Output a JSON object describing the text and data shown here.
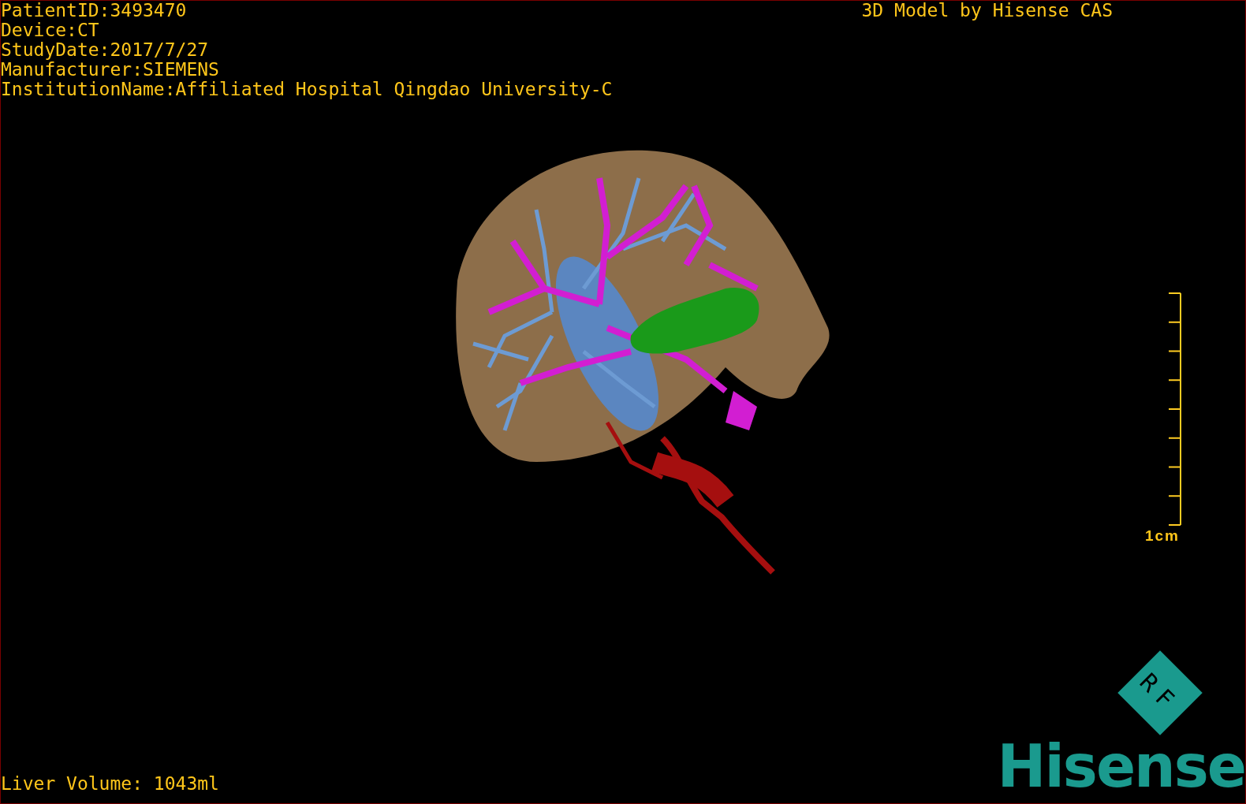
{
  "patient_info": [
    "PatientID:3493470",
    "Device:CT",
    "StudyDate:2017/7/27",
    "Manufacturer:SIEMENS",
    "InstitutionName:Affiliated Hospital Qingdao University-C"
  ],
  "title": "3D Model by Hisense CAS",
  "scale_bar": {
    "label": "1cm"
  },
  "liver_volume": "Liver Volume: 1043ml",
  "logo": {
    "badge": "RF",
    "wordmark": "Hisense"
  }
}
